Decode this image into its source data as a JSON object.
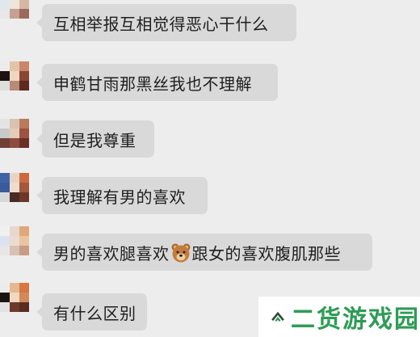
{
  "colors": {
    "background": "#ededed",
    "bubble": "#d9d9d9",
    "text": "#1e1e1e",
    "watermark_green": "#2e9c55",
    "watermark_dark": "#33483b"
  },
  "messages": [
    {
      "text": "互相举报互相觉得恶心干什么"
    },
    {
      "text": "申鹤甘雨那黑丝我也不理解"
    },
    {
      "text": "但是我尊重"
    },
    {
      "text": "我理解有男的喜欢"
    },
    {
      "text_before": "男的喜欢腿喜欢",
      "emoji": "bear-face-emoji",
      "text_after": "跟女的喜欢腹肌那些"
    },
    {
      "text": "有什么区别"
    }
  ],
  "watermark": {
    "text": "二货游戏园",
    "icon": "chevron-logo-icon"
  }
}
